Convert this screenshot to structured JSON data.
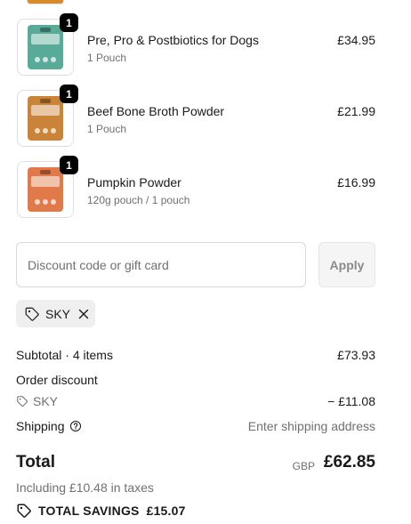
{
  "line_items": [
    {
      "name": "Pre, Pro & Postbiotics for Dogs",
      "variant": "1 Pouch",
      "price": "£34.95",
      "quantity": "1",
      "pouch_color": "#5aaa9a"
    },
    {
      "name": "Beef Bone Broth Powder",
      "variant": "1 Pouch",
      "price": "£21.99",
      "quantity": "1",
      "pouch_color": "#c9843a"
    },
    {
      "name": "Pumpkin Powder",
      "variant": "120g pouch / 1 pouch",
      "price": "£16.99",
      "quantity": "1",
      "pouch_color": "#e07a4a"
    }
  ],
  "discount": {
    "placeholder": "Discount code or gift card",
    "apply_label": "Apply",
    "applied_code": "SKY"
  },
  "summary": {
    "subtotal_label": "Subtotal · 4 items",
    "subtotal_value": "£73.93",
    "order_discount_label": "Order discount",
    "discount_code": "SKY",
    "discount_value": "− £11.08",
    "shipping_label": "Shipping",
    "shipping_value": "Enter shipping address",
    "total_label": "Total",
    "currency": "GBP",
    "total_value": "£62.85",
    "taxes_note": "Including £10.48 in taxes",
    "savings_label": "TOTAL SAVINGS",
    "savings_value": "£15.07"
  },
  "colors": {
    "text": "#1a1a1a",
    "muted": "#707070",
    "badge": "#000000",
    "chip_bg": "#efefef",
    "top_peek": "#d98a2a"
  }
}
